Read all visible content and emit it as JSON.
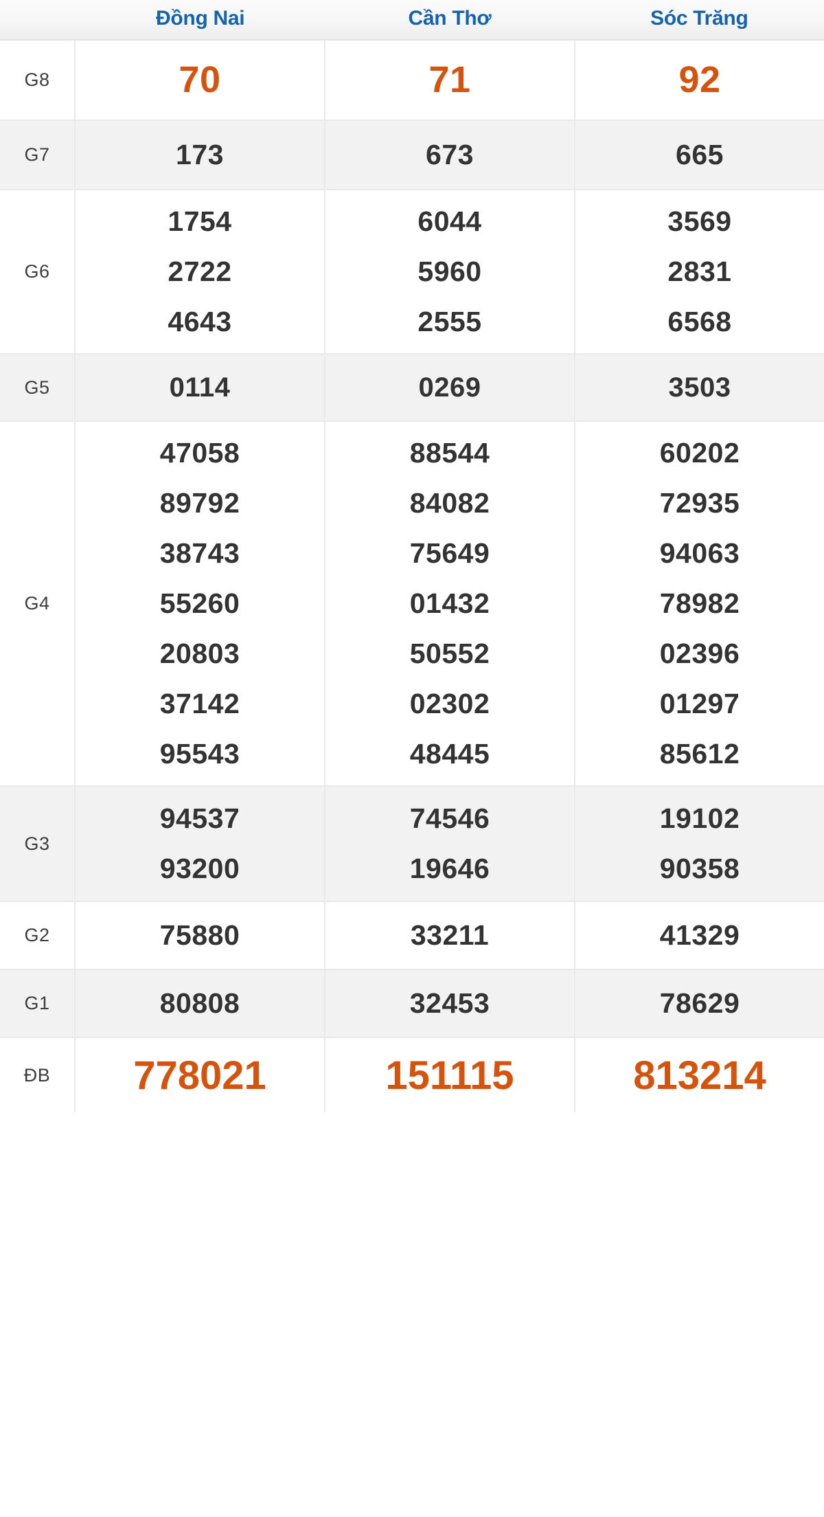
{
  "table": {
    "columns": [
      {
        "label": "Đồng Nai"
      },
      {
        "label": "Cần Thơ"
      },
      {
        "label": "Sóc Trăng"
      }
    ],
    "colors": {
      "header_text": "#1663ad",
      "highlight_number": "#d4540d",
      "normal_number": "#333333",
      "row_alt_background": "#f2f2f2",
      "row_background": "#ffffff",
      "border": "#e9e9e9",
      "label_text": "#3c3c3c"
    },
    "rows": [
      {
        "key": "g8",
        "label": "G8",
        "highlight": true,
        "cells": [
          [
            "70"
          ],
          [
            "71"
          ],
          [
            "92"
          ]
        ]
      },
      {
        "key": "g7",
        "label": "G7",
        "highlight": false,
        "cells": [
          [
            "173"
          ],
          [
            "673"
          ],
          [
            "665"
          ]
        ]
      },
      {
        "key": "g6",
        "label": "G6",
        "highlight": false,
        "cells": [
          [
            "1754",
            "2722",
            "4643"
          ],
          [
            "6044",
            "5960",
            "2555"
          ],
          [
            "3569",
            "2831",
            "6568"
          ]
        ]
      },
      {
        "key": "g5",
        "label": "G5",
        "highlight": false,
        "cells": [
          [
            "0114"
          ],
          [
            "0269"
          ],
          [
            "3503"
          ]
        ]
      },
      {
        "key": "g4",
        "label": "G4",
        "highlight": false,
        "cells": [
          [
            "47058",
            "89792",
            "38743",
            "55260",
            "20803",
            "37142",
            "95543"
          ],
          [
            "88544",
            "84082",
            "75649",
            "01432",
            "50552",
            "02302",
            "48445"
          ],
          [
            "60202",
            "72935",
            "94063",
            "78982",
            "02396",
            "01297",
            "85612"
          ]
        ]
      },
      {
        "key": "g3",
        "label": "G3",
        "highlight": false,
        "cells": [
          [
            "94537",
            "93200"
          ],
          [
            "74546",
            "19646"
          ],
          [
            "19102",
            "90358"
          ]
        ]
      },
      {
        "key": "g2",
        "label": "G2",
        "highlight": false,
        "cells": [
          [
            "75880"
          ],
          [
            "33211"
          ],
          [
            "41329"
          ]
        ]
      },
      {
        "key": "g1",
        "label": "G1",
        "highlight": false,
        "cells": [
          [
            "80808"
          ],
          [
            "32453"
          ],
          [
            "78629"
          ]
        ]
      },
      {
        "key": "db",
        "label": "ĐB",
        "highlight": true,
        "cells": [
          [
            "778021"
          ],
          [
            "151115"
          ],
          [
            "813214"
          ]
        ]
      }
    ]
  }
}
